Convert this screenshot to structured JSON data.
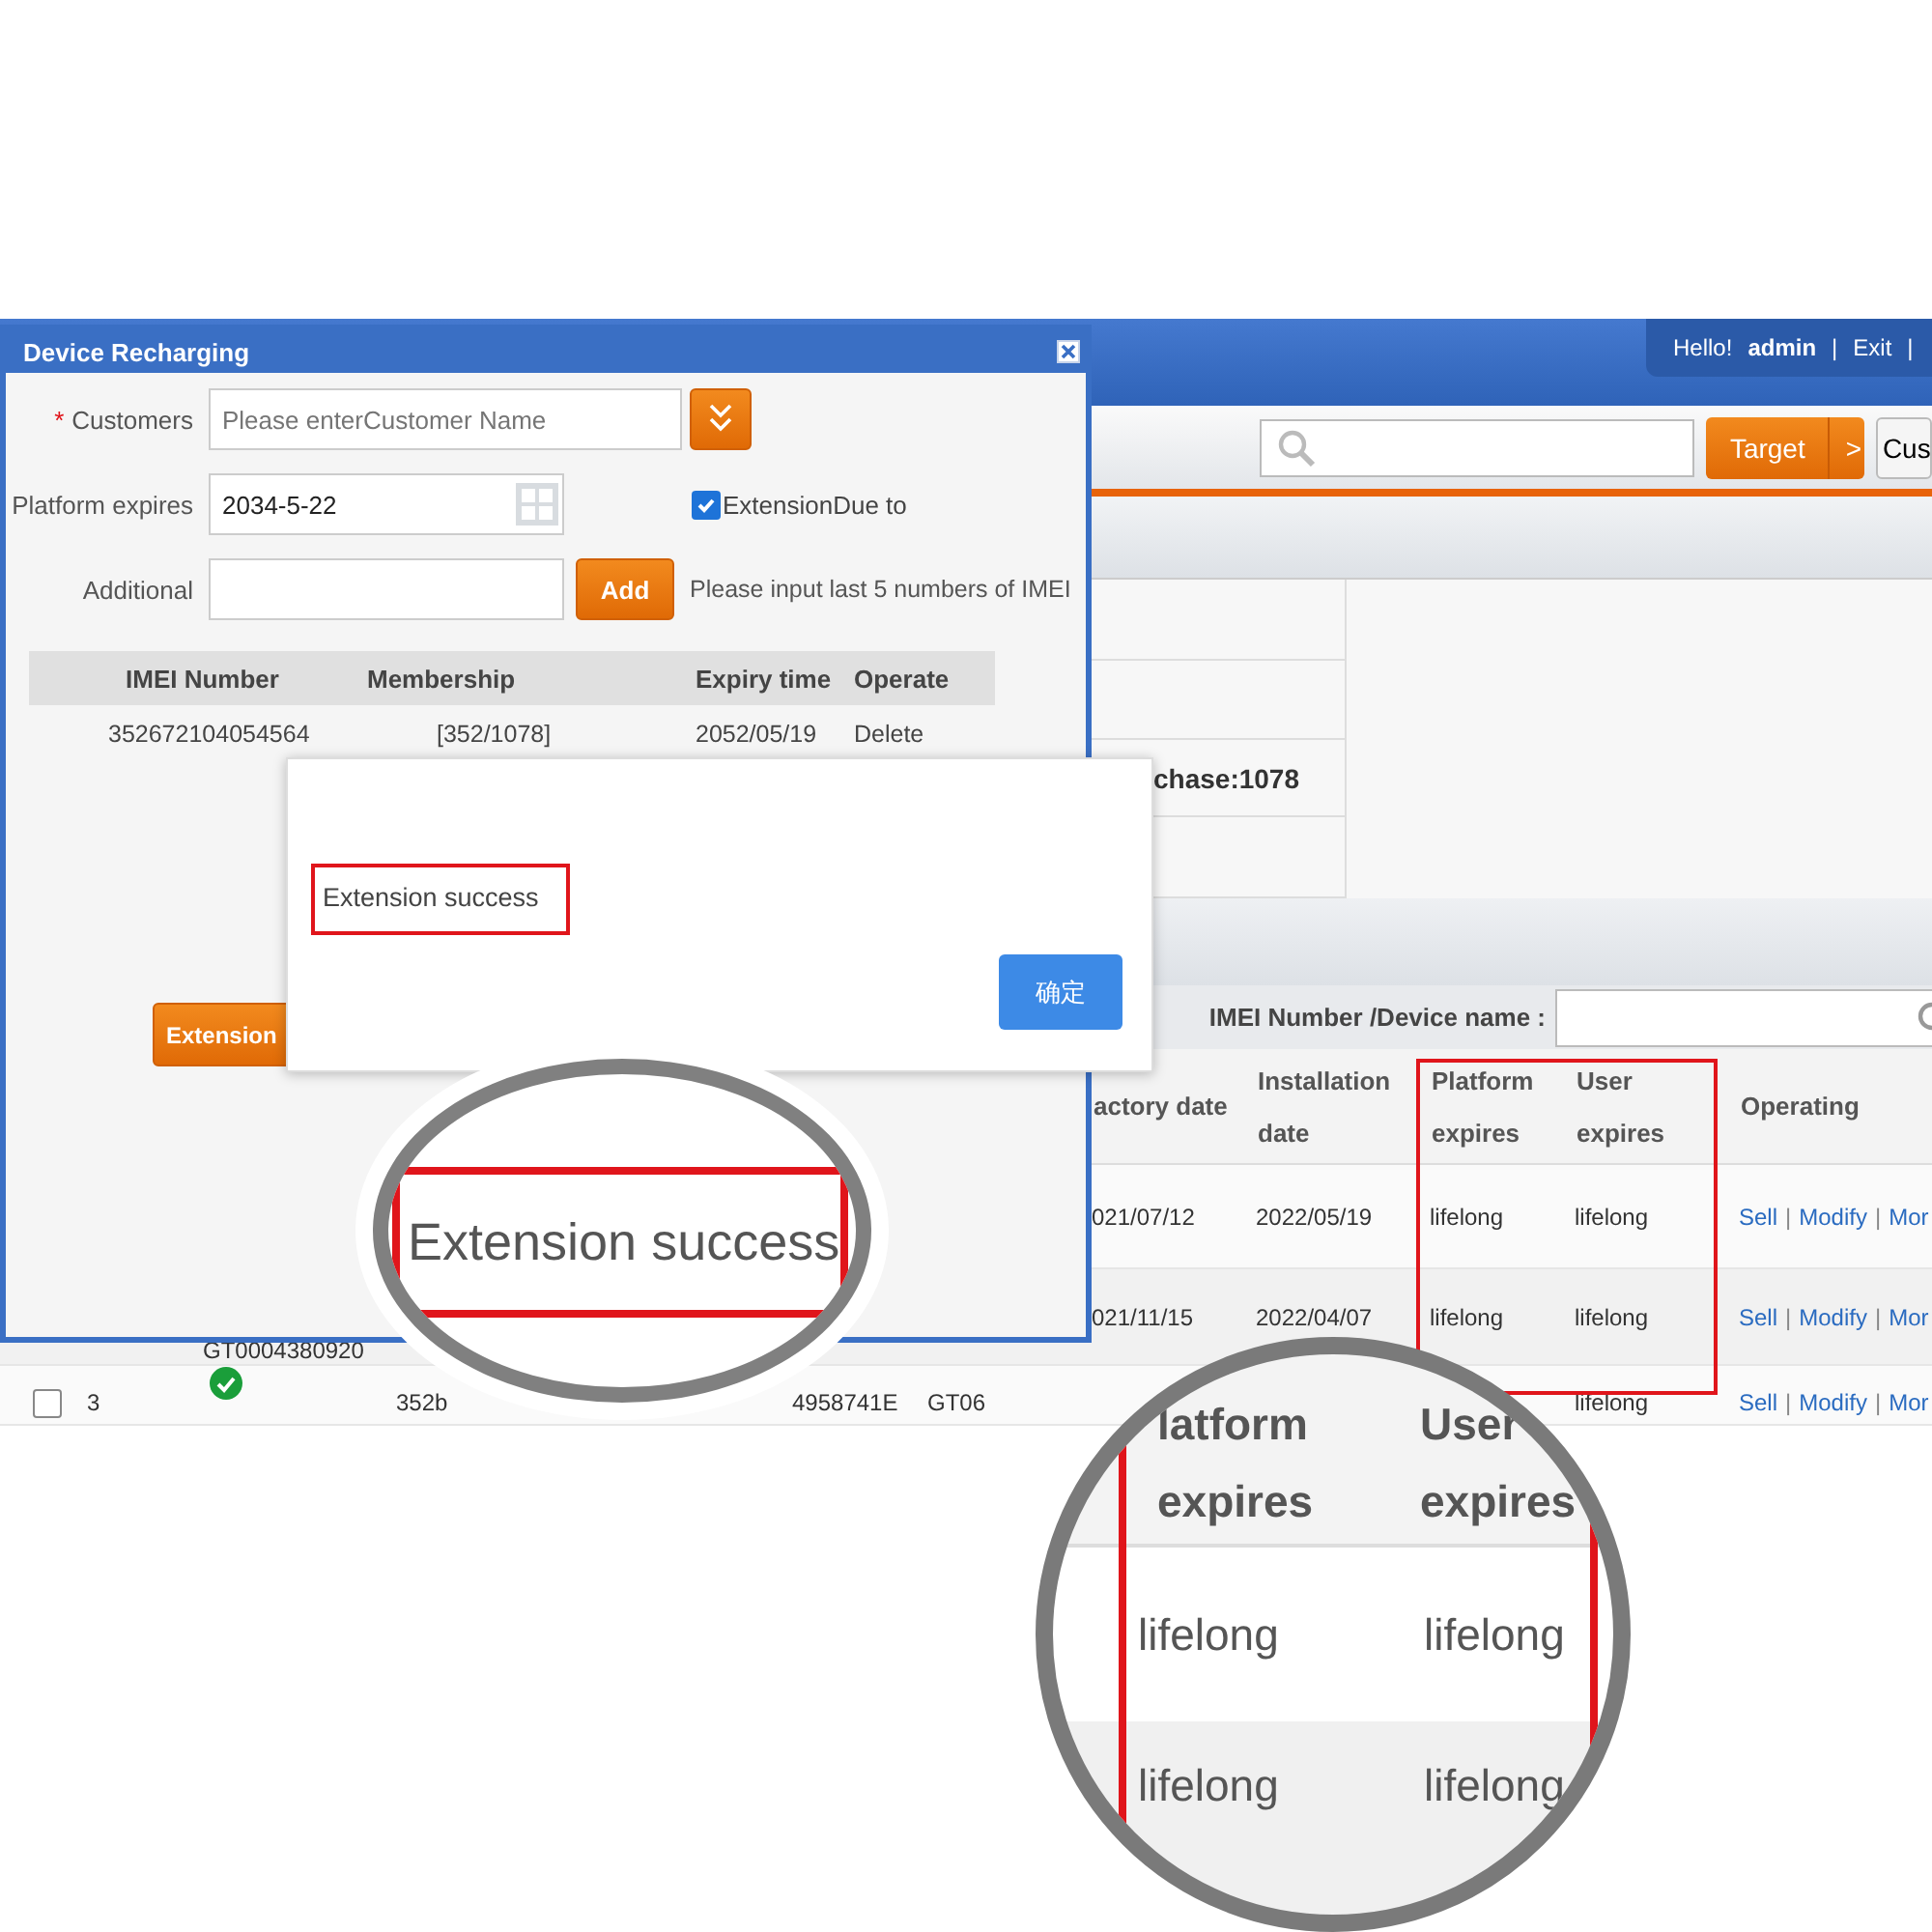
{
  "header": {
    "greeting": "Hello!",
    "user": "admin",
    "separators": [
      "|",
      "|"
    ],
    "exit_link": "Exit"
  },
  "toolbar": {
    "target_button": "Target",
    "target_arrow": ">",
    "next_button": "Cus"
  },
  "info_panel": {
    "text": "chase:1078"
  },
  "filter": {
    "label": "IMEI Number /Device name :"
  },
  "table": {
    "columns": [
      {
        "label": "actory date",
        "highlighted": false
      },
      {
        "label": "Installation date",
        "highlighted": false
      },
      {
        "label": "Platform expires",
        "highlighted": true
      },
      {
        "label": "User expires",
        "highlighted": true
      },
      {
        "label": "Operating",
        "highlighted": false
      }
    ],
    "rows": [
      {
        "kind": "upper",
        "factory_date": "021/07/12",
        "installation_date": "2022/05/19",
        "platform_expires": "lifelong",
        "user_expires": "lifelong",
        "actions": [
          {
            "kind": "link",
            "text": "Sell"
          },
          {
            "kind": "separator",
            "text": "|"
          },
          {
            "kind": "link",
            "text": "Modify"
          },
          {
            "kind": "separator",
            "text": "|"
          },
          {
            "kind": "link",
            "text": "Mor"
          }
        ]
      },
      {
        "kind": "upper",
        "device_name": "GT0004380920",
        "factory_date": "021/11/15",
        "installation_date": "2022/04/07",
        "platform_expires": "lifelong",
        "user_expires": "lifelong",
        "actions": [
          {
            "kind": "link",
            "text": "Sell"
          },
          {
            "kind": "separator",
            "text": "|"
          },
          {
            "kind": "link",
            "text": "Modify"
          },
          {
            "kind": "separator",
            "text": "|"
          },
          {
            "kind": "link",
            "text": "Mor"
          }
        ]
      },
      {
        "kind": "lower",
        "checked": false,
        "index": "3",
        "imei": "352b",
        "serial": "4958741E",
        "model": "GT06",
        "user_expires": "lifelong",
        "actions": [
          {
            "kind": "link",
            "text": "Sell"
          },
          {
            "kind": "separator",
            "text": "|"
          },
          {
            "kind": "link",
            "text": "Modify"
          },
          {
            "kind": "separator",
            "text": "|"
          },
          {
            "kind": "link",
            "text": "Mor"
          }
        ]
      }
    ]
  },
  "dialog": {
    "title": "Device Recharging",
    "required_mark": "*",
    "customers_label": "Customers",
    "customers_placeholder": "Please enterCustomer Name",
    "platform_label": "Platform expires",
    "platform_value": "2034-5-22",
    "extension_checkbox": {
      "label": "ExtensionDue to",
      "checked": true
    },
    "additional_label": "Additional",
    "add_button": "Add",
    "hint": "Please input last 5 numbers of IMEI",
    "devices": {
      "columns": [
        "IMEI Number",
        "Membership",
        "Expiry time",
        "Operate"
      ],
      "rows": [
        {
          "imei": "352672104054564",
          "membership": "[352/1078]",
          "expiry": "2052/05/19",
          "action": "Delete"
        }
      ]
    },
    "extension_button": "Extension"
  },
  "alert": {
    "message": "Extension success",
    "highlighted": true,
    "ok_button": "确定"
  },
  "magnifiers": [
    {
      "kind": "message",
      "text": "Extension success"
    },
    {
      "kind": "columns",
      "columns": [
        {
          "title_lines": [
            "latform",
            "expires"
          ],
          "values": [
            "lifelong",
            "lifelong"
          ]
        },
        {
          "title_lines": [
            "User",
            "expires"
          ],
          "values": [
            "lifelong",
            "lifelong"
          ]
        }
      ]
    }
  ]
}
